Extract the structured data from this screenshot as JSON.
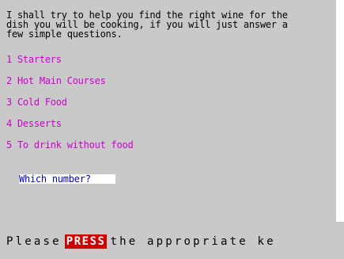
{
  "intro": {
    "lines": [
      "I shall try to help you find the right wine for the",
      "dish you will be cooking, if you will just answer a",
      "few simple questions."
    ]
  },
  "menu": {
    "items": [
      {
        "label": "1 Starters"
      },
      {
        "label": "2 Hot Main Courses"
      },
      {
        "label": "3 Cold Food"
      },
      {
        "label": "4 Desserts"
      },
      {
        "label": "5 To drink without food"
      }
    ]
  },
  "prompt": {
    "text": "Which number? "
  },
  "footer": {
    "before": "Please",
    "press": "PRESS",
    "after": "the appropriate ke"
  },
  "colors": {
    "background": "#c9c9c9",
    "menu": "#cc00cc",
    "prompt_text": "#0000cc",
    "press_badge": "#cc0000"
  }
}
